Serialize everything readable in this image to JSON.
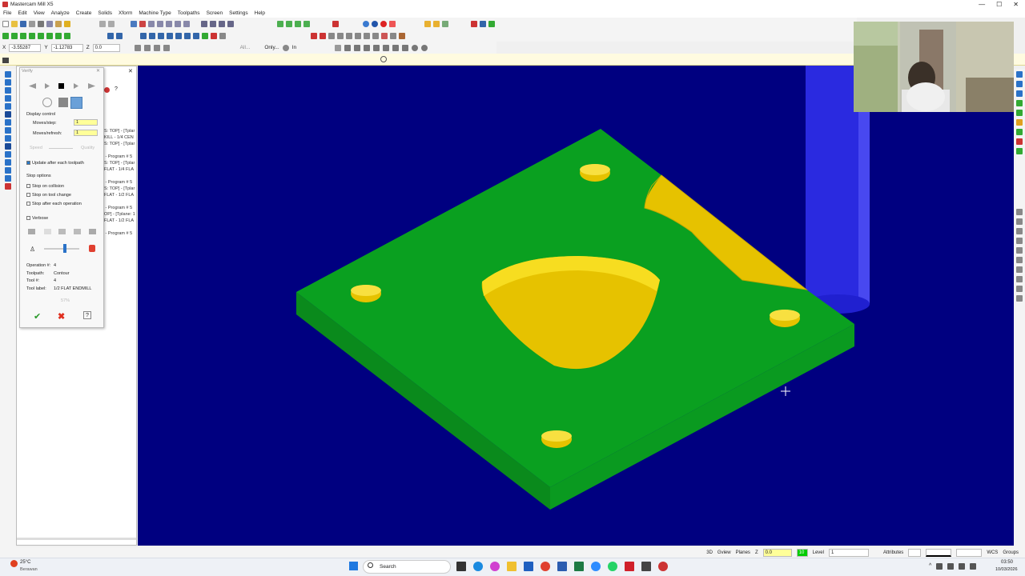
{
  "window": {
    "title": "Mastercam Mill X5",
    "controls": [
      "—",
      "☐",
      "✕"
    ]
  },
  "menu": [
    "File",
    "Edit",
    "View",
    "Analyze",
    "Create",
    "Solids",
    "Xform",
    "Machine Type",
    "Toolpaths",
    "Screen",
    "Settings",
    "Help"
  ],
  "coords": {
    "x_label": "X",
    "x_value": "-3.55287",
    "y_label": "Y",
    "y_value": "-1.12783",
    "z_label": "Z",
    "z_value": "0.0",
    "all_label": "All...",
    "only_label": "Only...",
    "in_label": "In"
  },
  "ops_tree": "S: TOP] - [Tplar\nKILL - 1/4 CEN\nS: TOP] - [Tplar\n\n - Program # 5\nS: TOP] - [Tplar\nFLAT - 1/4 FLA\n\n - Program # 5\nS: TOP] - [Tplar\nFLAT - 1/2 FLA\n\n - Program # 5\nOP] - [Tplane: 1\nFLAT - 1/2 FLA\n\n - Program # 5",
  "verify": {
    "title": "Verify",
    "display_control": "Display control",
    "moves_step_label": "Moves/step:",
    "moves_step_value": "1",
    "moves_refresh_label": "Moves/refresh:",
    "moves_refresh_value": "1",
    "speed_label": "Speed",
    "quality_label": "Quality",
    "update_label": "Update after each toolpath",
    "stop_options": "Stop options",
    "stop_collision": "Stop on collision",
    "stop_tool_change": "Stop on tool change",
    "stop_each_op": "Stop after each operation",
    "verbose": "Verbose",
    "operation_label": "Operation #:",
    "operation_value": "4",
    "toolpath_label": "Toolpath:",
    "toolpath_value": "Contour",
    "tool_label": "Tool #:",
    "tool_value": "4",
    "tool_name_label": "Tool label:",
    "tool_name_value": "1/2 FLAT ENDMILL",
    "progress_text": "57%",
    "progress": 0.57
  },
  "status": {
    "mode": "3D",
    "gview": "Gview",
    "planes": "Planes",
    "z_label": "Z",
    "z_value": "0.0",
    "color_value": "10",
    "level_label": "Level",
    "level_value": "1",
    "attributes": "Attributes",
    "wcs": "WCS",
    "groups": "Groups"
  },
  "taskbar": {
    "weather_temp": "25°C",
    "weather_desc": "Berawan",
    "search": "Search",
    "time": "03:50",
    "date": "10/03/2026"
  },
  "colors": {
    "viewport": "#000080",
    "stock": "#0aa020",
    "cut": "#e6c200",
    "tool": "#2020e0"
  }
}
